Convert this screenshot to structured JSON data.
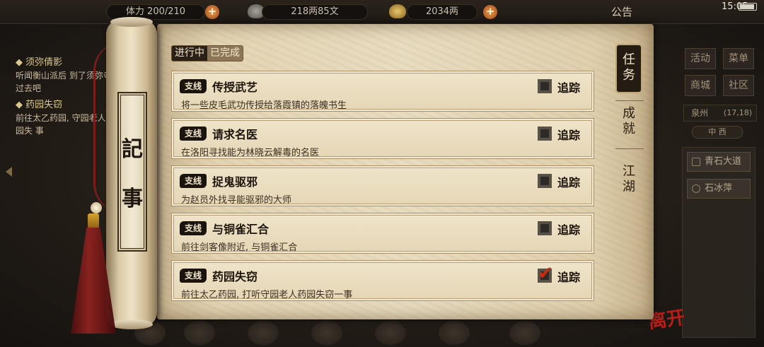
{
  "header": {
    "stamina": "体力 200/210",
    "money": "218两85文",
    "gold": "2034两",
    "notice": "公告",
    "clock": "15:05"
  },
  "left_panel": {
    "quests": [
      {
        "title": "须弥倩影",
        "desc": "听闻衡山派后 到了须弥寺, 过去吧"
      },
      {
        "title": "药园失窃",
        "desc": "前往太乙药园, 守园老人药园失 事"
      }
    ]
  },
  "right_panel": {
    "buttons": [
      "活动",
      "菜单",
      "商城",
      "社区"
    ],
    "location": "泉州",
    "coords": "(17,18)",
    "compass": "中 西",
    "npcs": [
      "青石大道",
      "石冰萍"
    ]
  },
  "scroll": {
    "roller_chars": [
      "記",
      "事"
    ],
    "status_tabs": {
      "active": "进行中",
      "inactive": "已完成"
    },
    "side_tabs": [
      {
        "label": "任务",
        "active": true
      },
      {
        "label": "成就",
        "active": false
      },
      {
        "label": "江湖",
        "active": false
      }
    ],
    "quests": [
      {
        "tag": "支线",
        "title": "传授武艺",
        "desc": "将一些皮毛武功传授给落霞镇的落魄书生",
        "track_label": "追踪",
        "tracked": false
      },
      {
        "tag": "支线",
        "title": "请求名医",
        "desc": "在洛阳寻找能为林晓云解毒的名医",
        "track_label": "追踪",
        "tracked": false
      },
      {
        "tag": "支线",
        "title": "捉鬼驱邪",
        "desc": "为赵员外找寻能驱邪的大师",
        "track_label": "追踪",
        "tracked": false
      },
      {
        "tag": "支线",
        "title": "与铜雀汇合",
        "desc": "前往剑客像附近, 与铜雀汇合",
        "track_label": "追踪",
        "tracked": false
      },
      {
        "tag": "支线",
        "title": "药园失窃",
        "desc": "前往太乙药园, 打听守园老人药园失窃一事",
        "track_label": "追踪",
        "tracked": true
      }
    ]
  },
  "footer": {
    "leave_label": "离开"
  },
  "colors": {
    "paper": "#e8dcc0",
    "ink": "#1e160e",
    "accent_red": "#c72d14",
    "tassel": "#8e2320"
  }
}
